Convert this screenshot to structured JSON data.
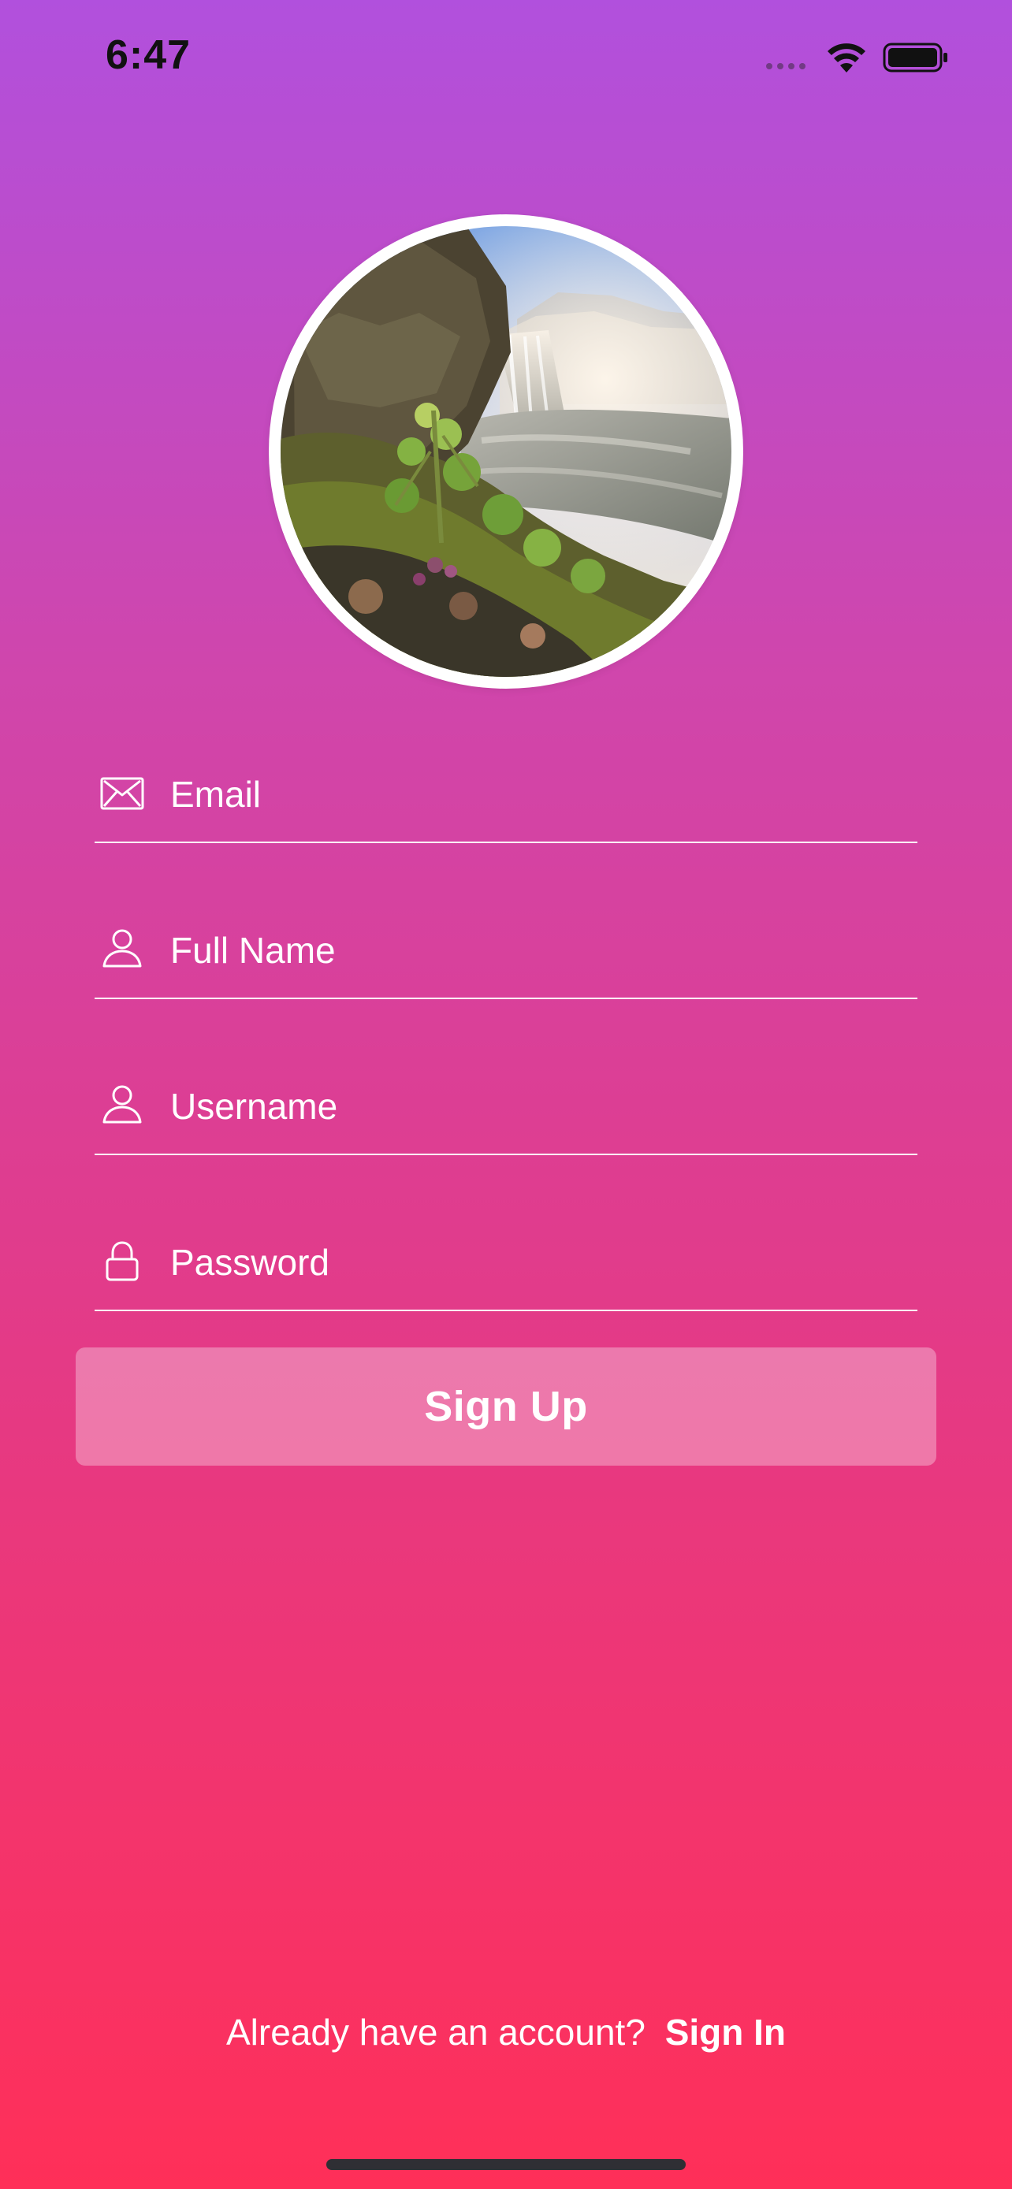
{
  "status_bar": {
    "time": "6:47",
    "signal_icon": "cellular-signal-dots",
    "wifi_icon": "wifi-icon",
    "battery_icon": "battery-icon"
  },
  "profile": {
    "image_description_icon": "profile-photo-waterfall"
  },
  "form": {
    "email": {
      "placeholder": "Email",
      "icon": "envelope-icon"
    },
    "full_name": {
      "placeholder": "Full Name",
      "icon": "person-icon"
    },
    "username": {
      "placeholder": "Username",
      "icon": "person-icon"
    },
    "password": {
      "placeholder": "Password",
      "icon": "lock-icon"
    },
    "submit_label": "Sign Up"
  },
  "footer": {
    "prompt": "Already have an account?",
    "link_label": "Sign In"
  },
  "colors": {
    "gradient_top": "#b150dd",
    "gradient_mid": "#e43a86",
    "gradient_bottom": "#ff2f58",
    "text": "#ffffff",
    "button_fill": "rgba(255,255,255,0.32)"
  }
}
